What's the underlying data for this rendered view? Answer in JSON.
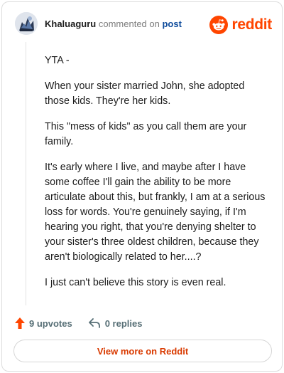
{
  "header": {
    "username": "Khaluaguru",
    "action_text": "commented on",
    "target_link": "post",
    "brand": "reddit"
  },
  "comment": {
    "paragraphs": [
      "YTA -",
      "When your sister married John, she adopted those kids. They're her kids.",
      "This \"mess of kids\" as you call them are your family.",
      "It's early where I live, and maybe after I have some coffee I'll gain the ability to be more articulate about this, but frankly, I am at a serious loss for words. You're genuinely saying, if I'm hearing you right, that you're denying shelter to your sister's three oldest children, because they aren't biologically related to her....?",
      "I just can't believe this story is even real."
    ]
  },
  "footer": {
    "upvotes_label": "9 upvotes",
    "replies_label": "0 replies",
    "view_more_label": "View more on Reddit"
  },
  "colors": {
    "reddit_orange": "#ff4500",
    "link_blue": "#0f4c9c",
    "view_more_text": "#d93a00"
  },
  "icons": {
    "avatar": "user-avatar",
    "brand": "reddit-snoo-icon",
    "upvote": "upvote-arrow-icon",
    "reply": "reply-arrow-icon"
  }
}
